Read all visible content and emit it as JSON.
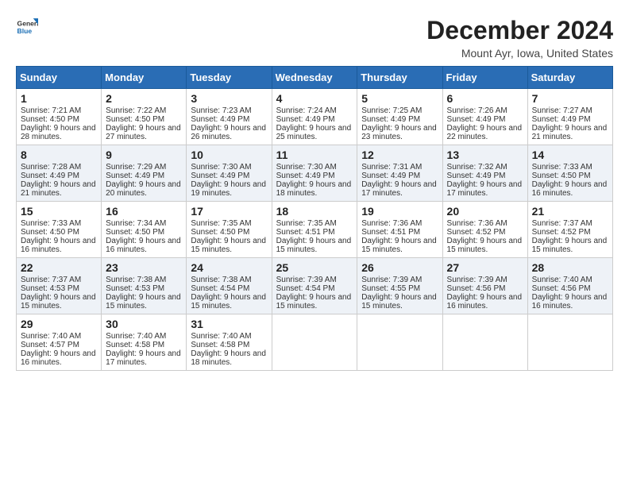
{
  "logo": {
    "general": "General",
    "blue": "Blue"
  },
  "header": {
    "title": "December 2024",
    "subtitle": "Mount Ayr, Iowa, United States"
  },
  "weekdays": [
    "Sunday",
    "Monday",
    "Tuesday",
    "Wednesday",
    "Thursday",
    "Friday",
    "Saturday"
  ],
  "weeks": [
    [
      {
        "day": "1",
        "sunrise": "7:21 AM",
        "sunset": "4:50 PM",
        "daylight": "9 hours and 28 minutes."
      },
      {
        "day": "2",
        "sunrise": "7:22 AM",
        "sunset": "4:50 PM",
        "daylight": "9 hours and 27 minutes."
      },
      {
        "day": "3",
        "sunrise": "7:23 AM",
        "sunset": "4:49 PM",
        "daylight": "9 hours and 26 minutes."
      },
      {
        "day": "4",
        "sunrise": "7:24 AM",
        "sunset": "4:49 PM",
        "daylight": "9 hours and 25 minutes."
      },
      {
        "day": "5",
        "sunrise": "7:25 AM",
        "sunset": "4:49 PM",
        "daylight": "9 hours and 23 minutes."
      },
      {
        "day": "6",
        "sunrise": "7:26 AM",
        "sunset": "4:49 PM",
        "daylight": "9 hours and 22 minutes."
      },
      {
        "day": "7",
        "sunrise": "7:27 AM",
        "sunset": "4:49 PM",
        "daylight": "9 hours and 21 minutes."
      }
    ],
    [
      {
        "day": "8",
        "sunrise": "7:28 AM",
        "sunset": "4:49 PM",
        "daylight": "9 hours and 21 minutes."
      },
      {
        "day": "9",
        "sunrise": "7:29 AM",
        "sunset": "4:49 PM",
        "daylight": "9 hours and 20 minutes."
      },
      {
        "day": "10",
        "sunrise": "7:30 AM",
        "sunset": "4:49 PM",
        "daylight": "9 hours and 19 minutes."
      },
      {
        "day": "11",
        "sunrise": "7:30 AM",
        "sunset": "4:49 PM",
        "daylight": "9 hours and 18 minutes."
      },
      {
        "day": "12",
        "sunrise": "7:31 AM",
        "sunset": "4:49 PM",
        "daylight": "9 hours and 17 minutes."
      },
      {
        "day": "13",
        "sunrise": "7:32 AM",
        "sunset": "4:49 PM",
        "daylight": "9 hours and 17 minutes."
      },
      {
        "day": "14",
        "sunrise": "7:33 AM",
        "sunset": "4:50 PM",
        "daylight": "9 hours and 16 minutes."
      }
    ],
    [
      {
        "day": "15",
        "sunrise": "7:33 AM",
        "sunset": "4:50 PM",
        "daylight": "9 hours and 16 minutes."
      },
      {
        "day": "16",
        "sunrise": "7:34 AM",
        "sunset": "4:50 PM",
        "daylight": "9 hours and 16 minutes."
      },
      {
        "day": "17",
        "sunrise": "7:35 AM",
        "sunset": "4:50 PM",
        "daylight": "9 hours and 15 minutes."
      },
      {
        "day": "18",
        "sunrise": "7:35 AM",
        "sunset": "4:51 PM",
        "daylight": "9 hours and 15 minutes."
      },
      {
        "day": "19",
        "sunrise": "7:36 AM",
        "sunset": "4:51 PM",
        "daylight": "9 hours and 15 minutes."
      },
      {
        "day": "20",
        "sunrise": "7:36 AM",
        "sunset": "4:52 PM",
        "daylight": "9 hours and 15 minutes."
      },
      {
        "day": "21",
        "sunrise": "7:37 AM",
        "sunset": "4:52 PM",
        "daylight": "9 hours and 15 minutes."
      }
    ],
    [
      {
        "day": "22",
        "sunrise": "7:37 AM",
        "sunset": "4:53 PM",
        "daylight": "9 hours and 15 minutes."
      },
      {
        "day": "23",
        "sunrise": "7:38 AM",
        "sunset": "4:53 PM",
        "daylight": "9 hours and 15 minutes."
      },
      {
        "day": "24",
        "sunrise": "7:38 AM",
        "sunset": "4:54 PM",
        "daylight": "9 hours and 15 minutes."
      },
      {
        "day": "25",
        "sunrise": "7:39 AM",
        "sunset": "4:54 PM",
        "daylight": "9 hours and 15 minutes."
      },
      {
        "day": "26",
        "sunrise": "7:39 AM",
        "sunset": "4:55 PM",
        "daylight": "9 hours and 15 minutes."
      },
      {
        "day": "27",
        "sunrise": "7:39 AM",
        "sunset": "4:56 PM",
        "daylight": "9 hours and 16 minutes."
      },
      {
        "day": "28",
        "sunrise": "7:40 AM",
        "sunset": "4:56 PM",
        "daylight": "9 hours and 16 minutes."
      }
    ],
    [
      {
        "day": "29",
        "sunrise": "7:40 AM",
        "sunset": "4:57 PM",
        "daylight": "9 hours and 16 minutes."
      },
      {
        "day": "30",
        "sunrise": "7:40 AM",
        "sunset": "4:58 PM",
        "daylight": "9 hours and 17 minutes."
      },
      {
        "day": "31",
        "sunrise": "7:40 AM",
        "sunset": "4:58 PM",
        "daylight": "9 hours and 18 minutes."
      },
      null,
      null,
      null,
      null
    ]
  ]
}
